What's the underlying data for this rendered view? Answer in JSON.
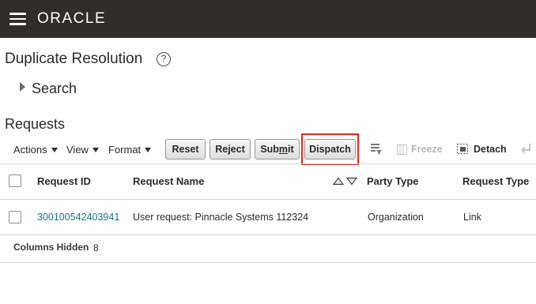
{
  "header": {
    "brand": "ORACLE"
  },
  "page": {
    "title": "Duplicate Resolution",
    "help_glyph": "?"
  },
  "search": {
    "label": "Search"
  },
  "requests": {
    "title": "Requests",
    "menus": {
      "actions": "Actions",
      "view": "View",
      "format": "Format"
    },
    "buttons": {
      "reset": "Reset",
      "reject": "Reject",
      "submit": {
        "pre": "Sub",
        "mnemonic": "m",
        "post": "it"
      },
      "dispatch": "Dispatch"
    },
    "tools": {
      "freeze": "Freeze",
      "detach": "Detach"
    },
    "columns": [
      "Request ID",
      "Request Name",
      "Party Type",
      "Request Type"
    ],
    "rows": [
      {
        "request_id": "300100542403941",
        "request_name": "User request: Pinnacle Systems 112324",
        "party_type": "Organization",
        "request_type": "Link"
      }
    ],
    "footer": {
      "columns_hidden_label": "Columns Hidden",
      "columns_hidden_count": "8"
    }
  },
  "colors": {
    "topbar": "#312d2a",
    "link": "#1f6f8b",
    "highlight": "#d92b25"
  },
  "icons": [
    "hamburger-menu-icon",
    "help-icon",
    "expand-triangle-icon",
    "caret-down-icon",
    "query-by-example-icon",
    "freeze-icon",
    "detach-icon",
    "wrap-icon",
    "sort-ascending-icon",
    "sort-descending-icon"
  ]
}
